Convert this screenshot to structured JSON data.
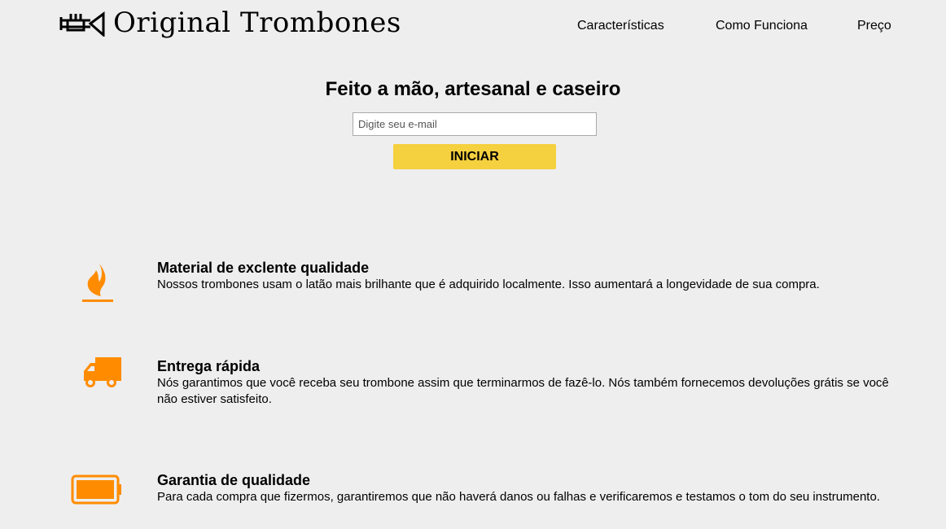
{
  "header": {
    "brand": "Original Trombones",
    "nav": [
      "Características",
      "Como Funciona",
      "Preço"
    ]
  },
  "hero": {
    "title": "Feito a mão, artesanal e caseiro",
    "email_placeholder": "Digite seu e-mail",
    "button": "INICIAR"
  },
  "features": [
    {
      "icon": "fire-icon",
      "title": "Material de exclente qualidade",
      "text": "Nossos trombones usam o latão mais brilhante que é adquirido localmente. Isso aumentará a longevidade de sua compra."
    },
    {
      "icon": "truck-icon",
      "title": "Entrega rápida",
      "text": "Nós garantimos que você receba seu trombone assim que terminarmos de fazê-lo. Nós também fornecemos devoluções grátis se você não estiver satisfeito."
    },
    {
      "icon": "battery-icon",
      "title": "Garantia de qualidade",
      "text": "Para cada compra que fizermos, garantiremos que não haverá danos ou falhas e verificaremos e testamos o tom do seu instrumento."
    }
  ],
  "colors": {
    "accent": "#ff8c00",
    "button": "#f5d03f"
  }
}
